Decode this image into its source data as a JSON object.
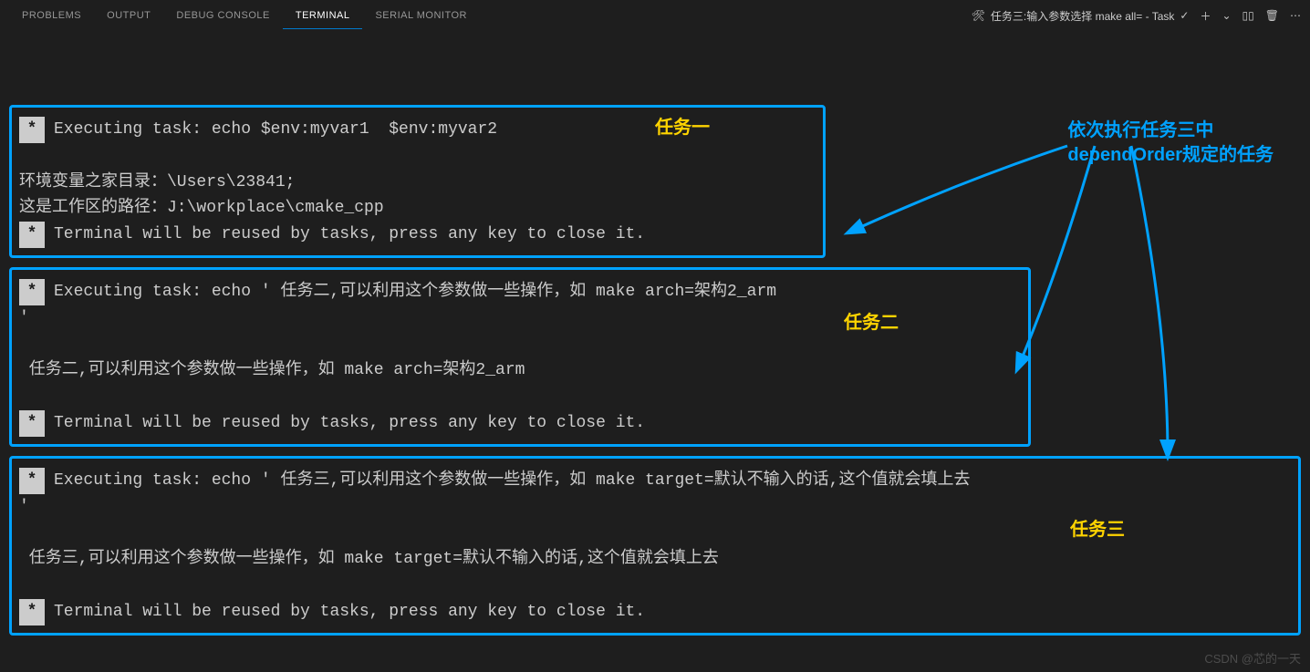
{
  "tabs": {
    "problems": "PROBLEMS",
    "output": "OUTPUT",
    "debug": "DEBUG CONSOLE",
    "terminal": "TERMINAL",
    "serial": "SERIAL MONITOR"
  },
  "taskbar": {
    "task_label": "任务三:输入参数选择 make all= - Task",
    "check": "✓",
    "plus": "＋",
    "chev": "⌄",
    "split": "▯▯",
    "trash": "🗑",
    "more": "⋯"
  },
  "annot": {
    "line1": "依次执行任务三中",
    "line2": "dependOrder规定的任务"
  },
  "labels": {
    "t1": "任务一",
    "t2": "任务二",
    "t3": "任务三"
  },
  "task1": {
    "exec": "Executing task: echo $env:myvar1  $env:myvar2 ",
    "l1": "环境变量之家目录：\\Users\\23841;",
    "l2": "这是工作区的路径：J:\\workplace\\cmake_cpp",
    "reuse": "Terminal will be reused by tasks, press any key to close it."
  },
  "task2": {
    "exec": "Executing task: echo ' 任务二,可以利用这个参数做一些操作，如 make arch=架构2_arm",
    "cont": "'",
    "out": " 任务二,可以利用这个参数做一些操作，如 make arch=架构2_arm",
    "reuse": "Terminal will be reused by tasks, press any key to close it."
  },
  "task3": {
    "exec": "Executing task: echo ' 任务三,可以利用这个参数做一些操作，如 make target=默认不输入的话,这个值就会填上去",
    "cont": "'",
    "out": " 任务三,可以利用这个参数做一些操作，如 make target=默认不输入的话,这个值就会填上去",
    "reuse": "Terminal will be reused by tasks, press any key to close it."
  },
  "watermark": "CSDN @芯的一天",
  "star": "*"
}
